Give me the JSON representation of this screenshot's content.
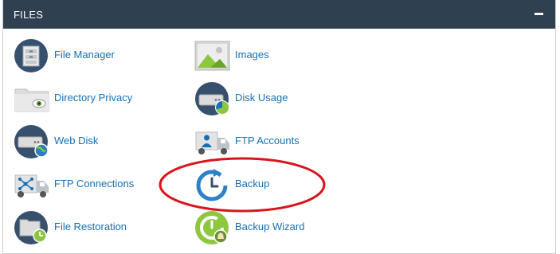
{
  "panel": {
    "title": "FILES",
    "collapse_icon": "minus-icon"
  },
  "items": [
    {
      "label": "File Manager",
      "icon": "file-manager-icon"
    },
    {
      "label": "Images",
      "icon": "images-icon"
    },
    {
      "label": "Directory Privacy",
      "icon": "directory-privacy-icon"
    },
    {
      "label": "Disk Usage",
      "icon": "disk-usage-icon"
    },
    {
      "label": "Web Disk",
      "icon": "web-disk-icon"
    },
    {
      "label": "FTP Accounts",
      "icon": "ftp-accounts-icon"
    },
    {
      "label": "FTP Connections",
      "icon": "ftp-connections-icon"
    },
    {
      "label": "Backup",
      "icon": "backup-icon"
    },
    {
      "label": "File Restoration",
      "icon": "file-restoration-icon"
    },
    {
      "label": "Backup Wizard",
      "icon": "backup-wizard-icon"
    }
  ],
  "colors": {
    "header_bg": "#2f4050",
    "link": "#1570b5",
    "highlight_ring": "#d9151c"
  }
}
